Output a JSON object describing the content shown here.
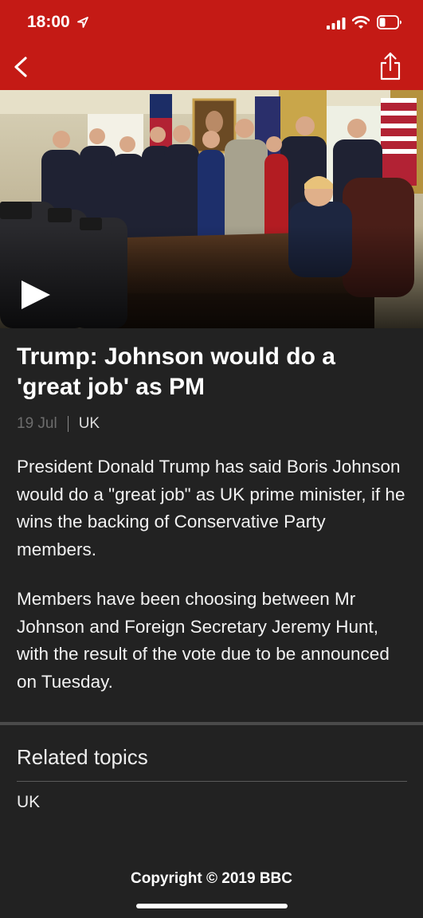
{
  "status_bar": {
    "time": "18:00",
    "icons": [
      "location-arrow-icon",
      "cellular-signal-icon",
      "wifi-icon",
      "battery-low-icon"
    ]
  },
  "nav": {
    "back_icon": "chevron-left-icon",
    "share_icon": "share-icon",
    "bar_color": "#c41a15"
  },
  "media": {
    "type": "video",
    "play_icon": "play-icon"
  },
  "article": {
    "headline": "Trump: Johnson would do a 'great job' as PM",
    "date": "19 Jul",
    "topic": "UK",
    "paragraphs": [
      "President Donald Trump has said Boris Johnson would do a \"great job\" as UK prime minister, if he wins the backing of Conservative Party members.",
      "Members have been choosing between Mr Johnson and Foreign Secretary Jeremy Hunt, with the result of the vote due to be announced on Tuesday."
    ]
  },
  "related": {
    "title": "Related topics",
    "items": [
      "UK"
    ]
  },
  "footer": {
    "copyright": "Copyright © 2019 BBC"
  }
}
